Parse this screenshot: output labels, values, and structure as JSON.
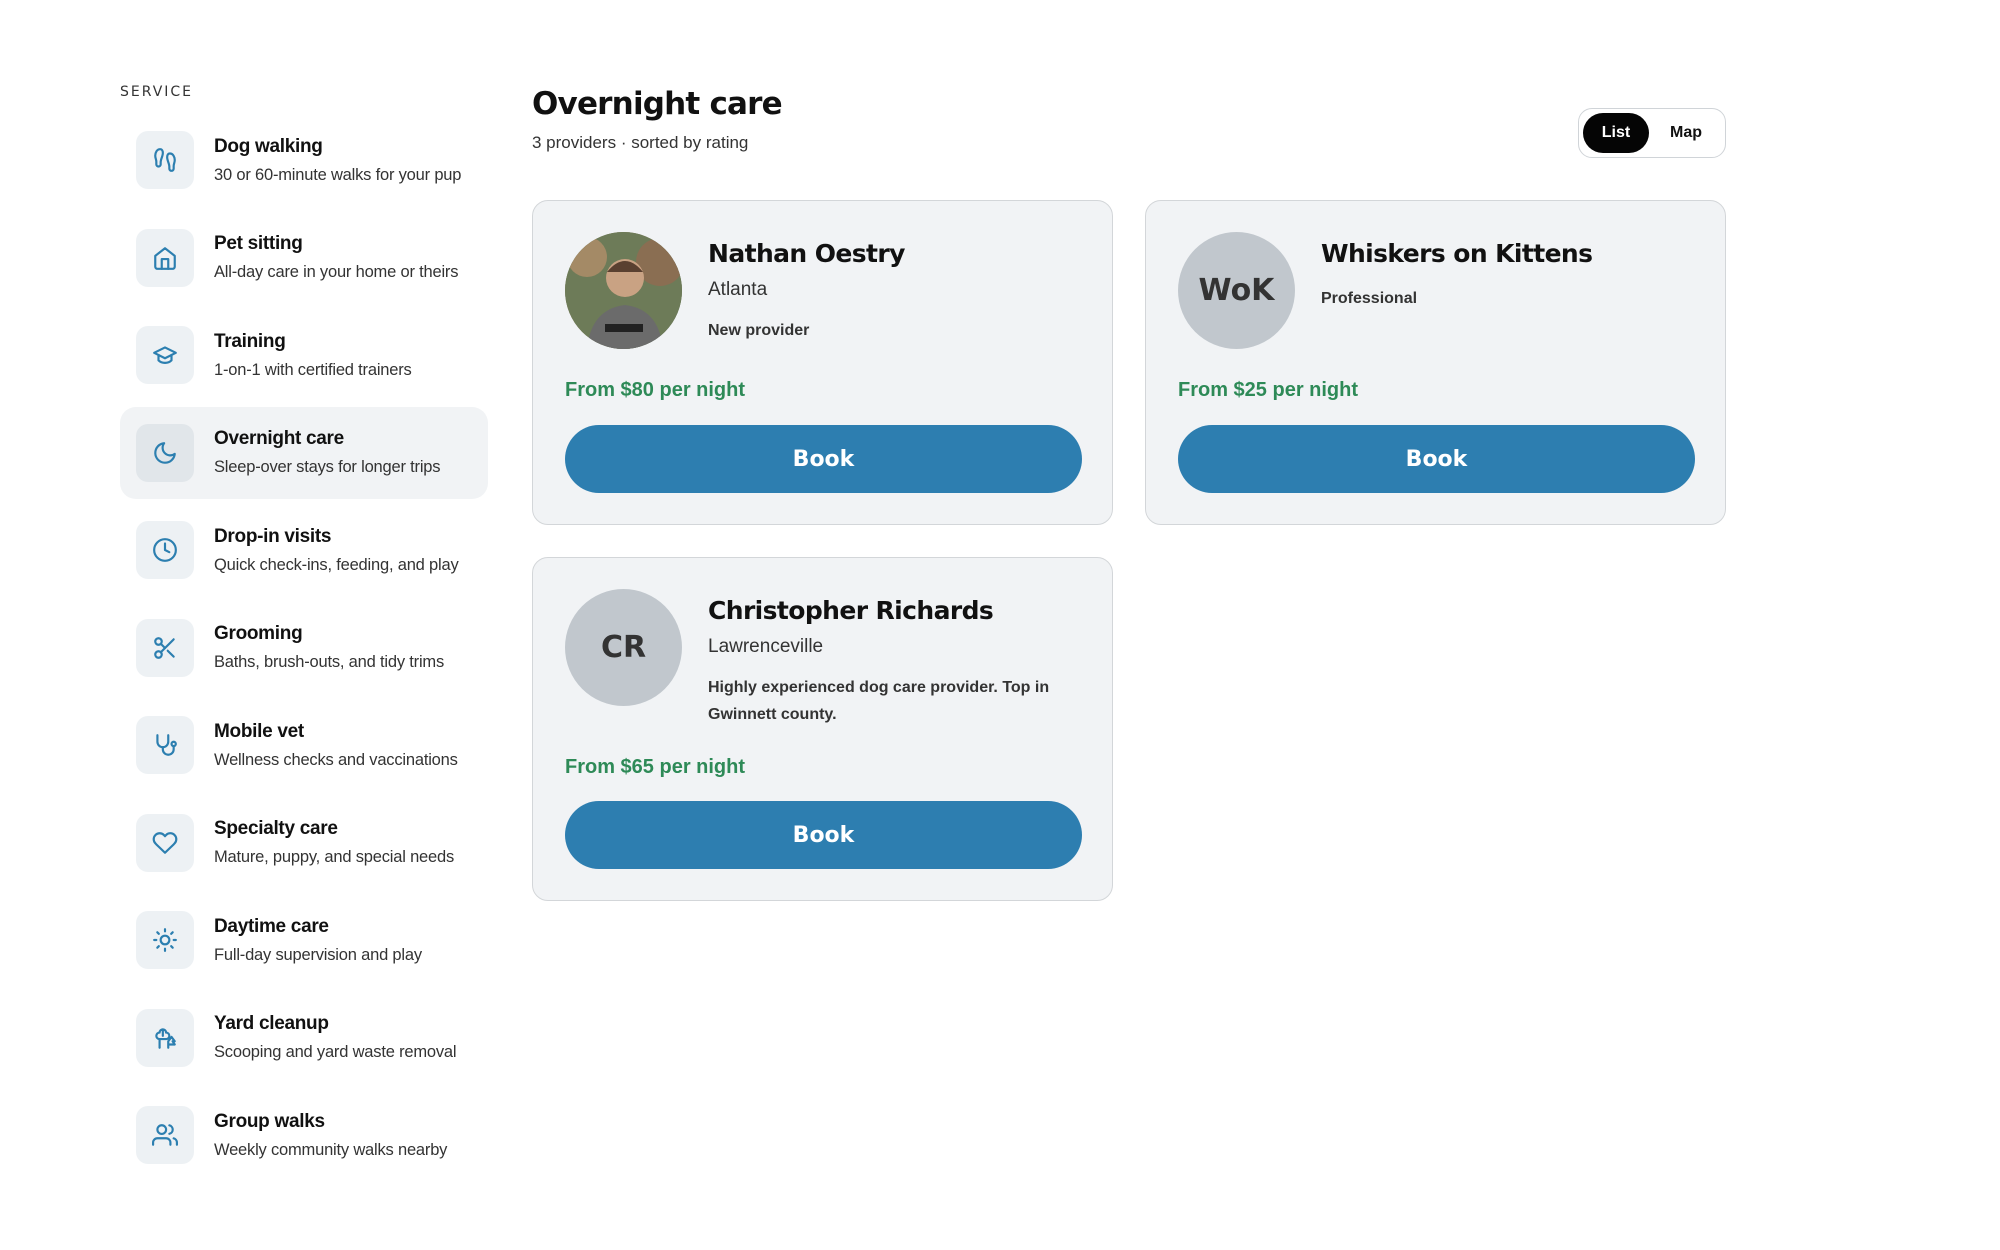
{
  "sidebar": {
    "heading": "SERVICE",
    "items": [
      {
        "title": "Dog walking",
        "subtitle": "30 or 60-minute walks for your pup",
        "icon": "footprints-icon"
      },
      {
        "title": "Pet sitting",
        "subtitle": "All-day care in your home or theirs",
        "icon": "home-icon"
      },
      {
        "title": "Training",
        "subtitle": "1-on-1 with certified trainers",
        "icon": "graduation-cap-icon"
      },
      {
        "title": "Overnight care",
        "subtitle": "Sleep-over stays for longer trips",
        "icon": "moon-icon"
      },
      {
        "title": "Drop-in visits",
        "subtitle": "Quick check-ins, feeding, and play",
        "icon": "clock-icon"
      },
      {
        "title": "Grooming",
        "subtitle": "Baths, brush-outs, and tidy trims",
        "icon": "scissors-icon"
      },
      {
        "title": "Mobile vet",
        "subtitle": "Wellness checks and vaccinations",
        "icon": "stethoscope-icon"
      },
      {
        "title": "Specialty care",
        "subtitle": "Mature, puppy, and special needs",
        "icon": "heart-icon"
      },
      {
        "title": "Daytime care",
        "subtitle": "Full-day supervision and play",
        "icon": "sun-icon"
      },
      {
        "title": "Yard cleanup",
        "subtitle": "Scooping and yard waste removal",
        "icon": "trees-icon"
      },
      {
        "title": "Group walks",
        "subtitle": "Weekly community walks nearby",
        "icon": "users-icon"
      }
    ],
    "active_index": 3
  },
  "main": {
    "title": "Overnight care",
    "subtitle": "3 providers · sorted by rating",
    "view_toggle": {
      "list": "List",
      "map": "Map",
      "selected": "List"
    }
  },
  "providers": [
    {
      "name": "Nathan Oestry",
      "city": "Atlanta",
      "tag": "New provider",
      "price": "From $80 per night",
      "button": "Book",
      "avatar_initials": ""
    },
    {
      "name": "Whiskers on Kittens",
      "city": "",
      "tag": "Professional",
      "price": "From $25 per night",
      "button": "Book",
      "avatar_initials": "WoK"
    },
    {
      "name": "Christopher Richards",
      "city": "Lawrenceville",
      "tag": "Highly experienced dog care provider. Top in Gwinnett county.",
      "price": "From $65 per night",
      "button": "Book",
      "avatar_initials": "CR"
    }
  ],
  "colors": {
    "accent": "#2d7eb0",
    "price": "#2e8a57",
    "card_bg": "#f1f3f5"
  }
}
